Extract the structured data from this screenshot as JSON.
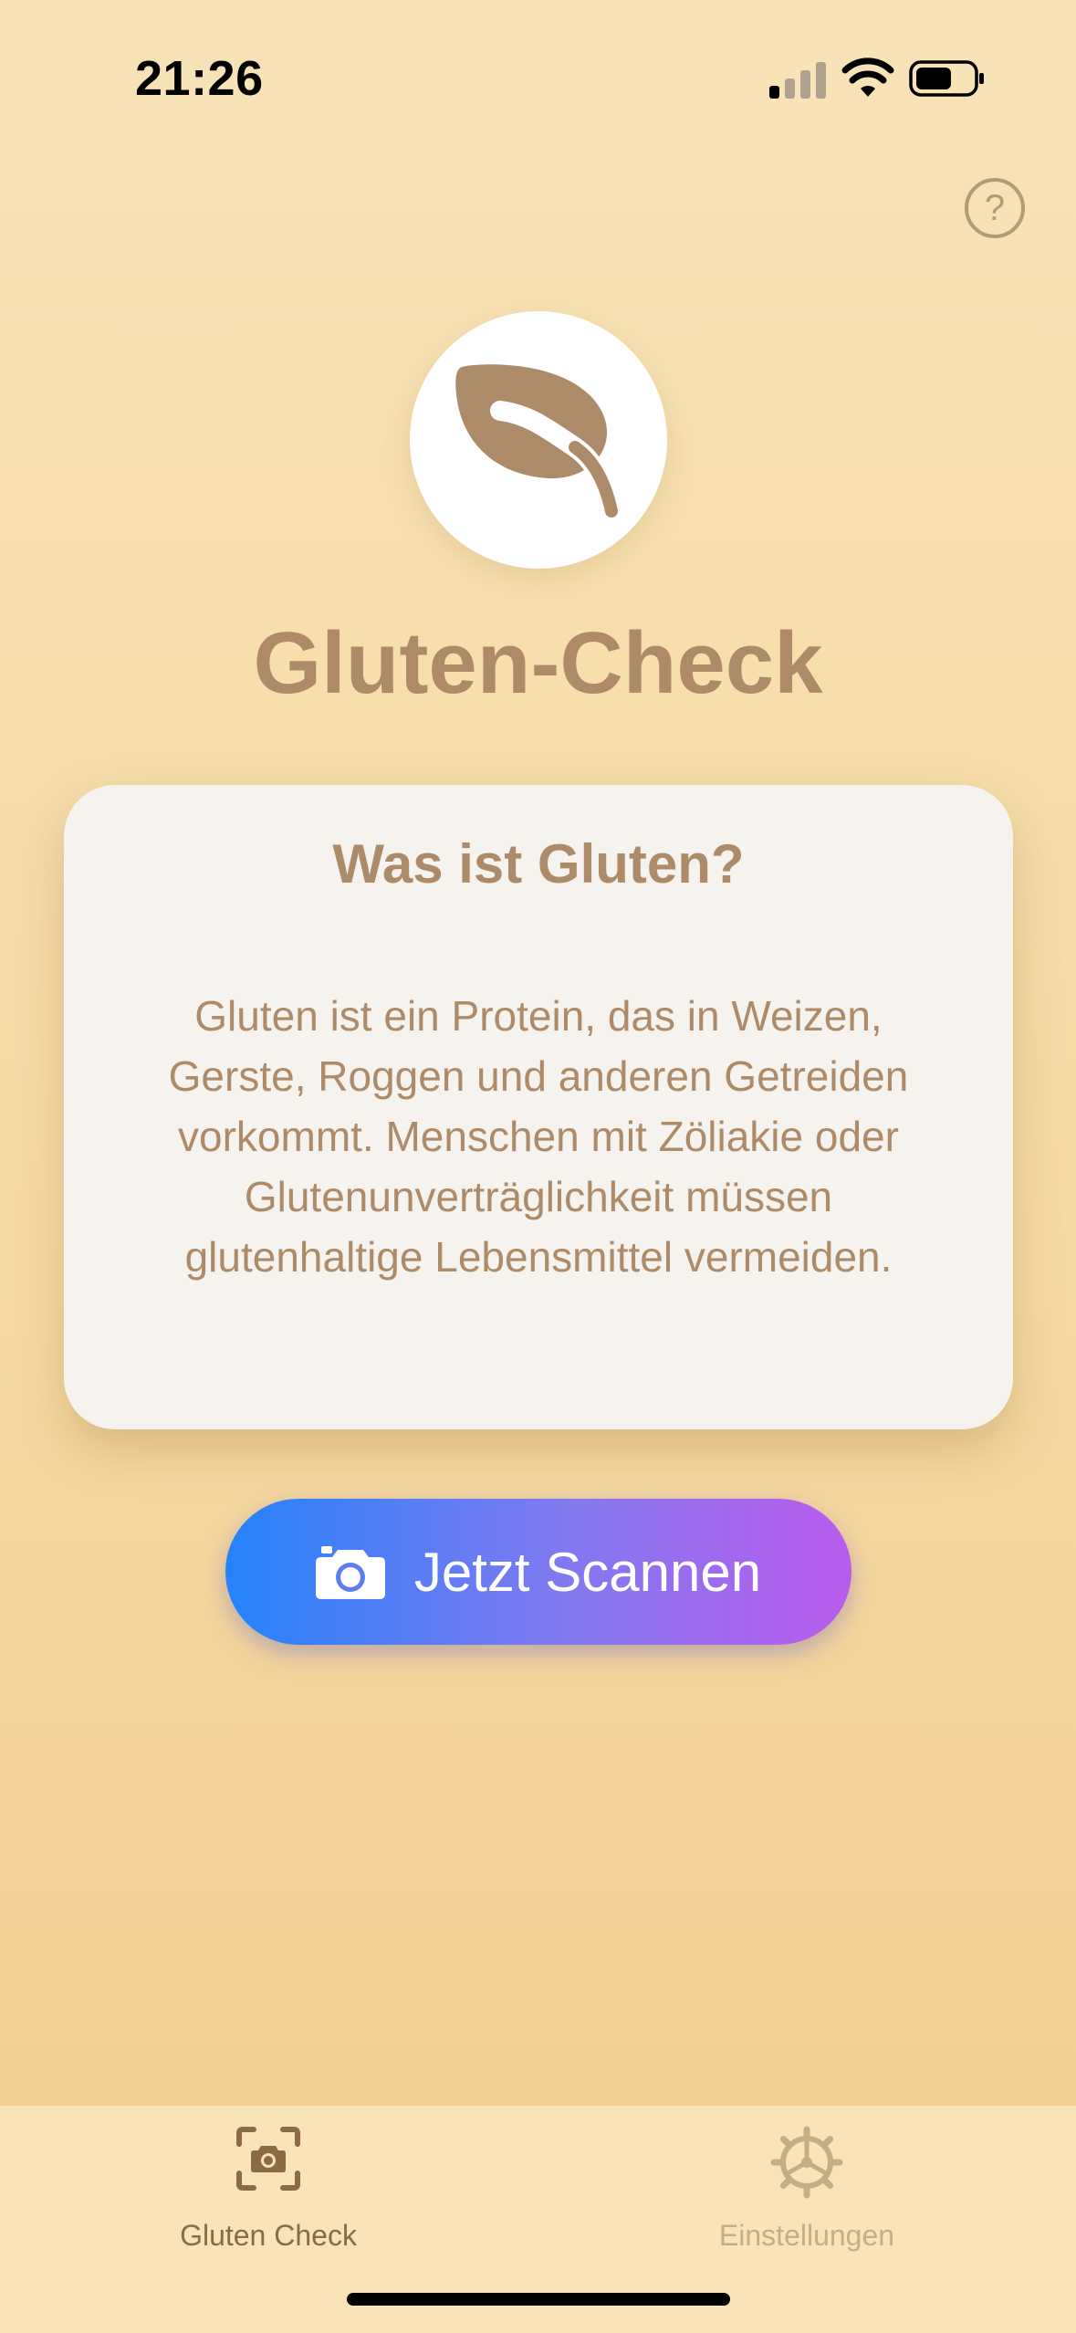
{
  "status_bar": {
    "time": "21:26",
    "icons": [
      "cellular-signal-icon",
      "wifi-icon",
      "battery-icon"
    ]
  },
  "header": {
    "help_icon": "question-circle-icon",
    "help_glyph": "?"
  },
  "logo": {
    "icon": "leaf-icon",
    "title": "Gluten-Check"
  },
  "info_card": {
    "heading": "Was ist Gluten?",
    "body": "Gluten ist ein Protein, das in Weizen, Gerste, Roggen und anderen Getreiden vorkommt. Menschen mit Zöliakie oder Glutenunverträglichkeit müssen glutenhaltige Lebensmittel vermeiden."
  },
  "scan_button": {
    "icon": "camera-icon",
    "label": "Jetzt Scannen"
  },
  "tab_bar": {
    "tabs": [
      {
        "label": "Gluten Check",
        "icon": "camera-scan-icon",
        "active": true
      },
      {
        "label": "Einstellungen",
        "icon": "gear-icon",
        "active": false
      }
    ]
  },
  "colors": {
    "background_top": "#f8e3b8",
    "background_bottom": "#f0cc8d",
    "accent_brown": "#ae8b68",
    "tab_active": "#8c6a45",
    "tab_inactive": "#c9ad82",
    "button_gradient_start": "#2583fb",
    "button_gradient_end": "#b95ced"
  }
}
